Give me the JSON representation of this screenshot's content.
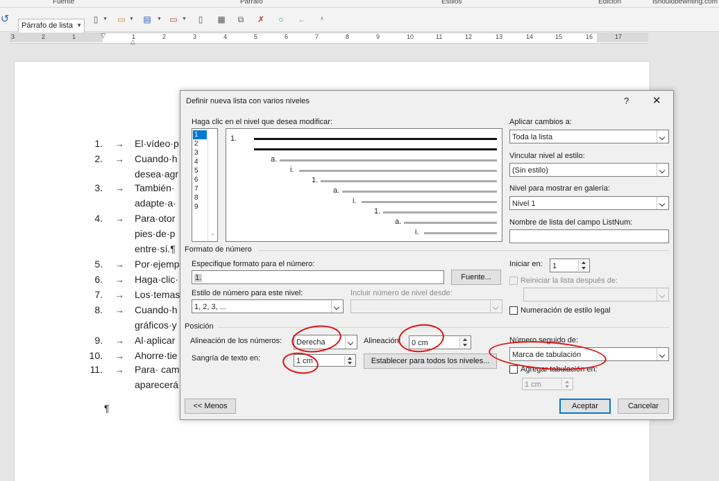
{
  "ribbon": {
    "groups": [
      "Fuente",
      "Párrafo",
      "Estilos",
      "Edición",
      "Ishouldbewriting.com"
    ]
  },
  "toolbar": {
    "style_value": "Párrafo de lista"
  },
  "ruler": {
    "numbers": [
      "3",
      "2",
      "1",
      "1",
      "2",
      "3",
      "4",
      "5",
      "6",
      "7",
      "8",
      "9",
      "10",
      "11",
      "12",
      "13",
      "14",
      "15",
      "16",
      "17"
    ]
  },
  "document": {
    "list": [
      {
        "num": "1.",
        "text": "El·vídeo·p"
      },
      {
        "num": "2.",
        "text": "Cuando·h"
      },
      {
        "num": "",
        "text": "desea·agr"
      },
      {
        "num": "3.",
        "text": "También·"
      },
      {
        "num": "",
        "text": "adapte·a·"
      },
      {
        "num": "4.",
        "text": "Para·otor"
      },
      {
        "num": "",
        "text": "pies·de·p"
      },
      {
        "num": "",
        "text": "entre·sí.¶"
      },
      {
        "num": "5.",
        "text": "Por·ejemp"
      },
      {
        "num": "6.",
        "text": "Haga·clic·"
      },
      {
        "num": "7.",
        "text": "Los·temas"
      },
      {
        "num": "8.",
        "text": "Cuando·h"
      },
      {
        "num": "",
        "text": "gráficos·y"
      },
      {
        "num": "9.",
        "text": "Al·aplicar"
      },
      {
        "num": "10.",
        "text": "Ahorre·tie"
      },
      {
        "num": "11.",
        "text": "Para· cam"
      },
      {
        "num": "",
        "text": "aparecerá"
      }
    ],
    "arrow": "→",
    "pilcrow": "¶"
  },
  "dialog": {
    "title": "Definir nueva lista con varios niveles",
    "help": "?",
    "close": "✕",
    "level_prompt": "Haga clic en el nivel que desea modificar:",
    "levels": [
      "1",
      "2",
      "3",
      "4",
      "5",
      "6",
      "7",
      "8",
      "9"
    ],
    "preview_labels": [
      "1.",
      "a.",
      "i.",
      "1.",
      "a.",
      "i.",
      "1.",
      "a.",
      "i."
    ],
    "apply_label": "Aplicar cambios a:",
    "apply_value": "Toda la lista",
    "link_label": "Vincular nivel al estilo:",
    "link_value": "(Sin estilo)",
    "gallery_label": "Nivel para mostrar en galería:",
    "gallery_value": "Nivel 1",
    "listnum_label": "Nombre de lista del campo ListNum:",
    "listnum_value": "",
    "number_format": {
      "section": "Formato de número",
      "format_label": "Especifique formato para el número:",
      "format_value": "1.",
      "font_button": "Fuente...",
      "style_label": "Estilo de número para este nivel:",
      "style_value": "1, 2, 3, ...",
      "include_label": "Incluir número de nivel desde:",
      "include_value": "",
      "start_label": "Iniciar en:",
      "start_value": "1",
      "restart_label": "Reiniciar la lista después de:",
      "legal_label": "Numeración de estilo legal"
    },
    "position": {
      "section": "Posición",
      "align_label": "Alineación de los números:",
      "align_value": "Derecha",
      "at_label": "Alineación:",
      "at_value": "0 cm",
      "indent_label": "Sangría de texto en:",
      "indent_value": "1 cm",
      "set_all_button": "Establecer para todos los niveles...",
      "follow_label": "Número seguido de:",
      "follow_value": "Marca de tabulación",
      "tab_label": "Agregar tabulación en:",
      "tab_value": "1 cm"
    },
    "less_button": "<< Menos",
    "ok_button": "Aceptar",
    "cancel_button": "Cancelar"
  },
  "colors": {
    "annotation": "#e01010",
    "selection": "#0078d7"
  }
}
